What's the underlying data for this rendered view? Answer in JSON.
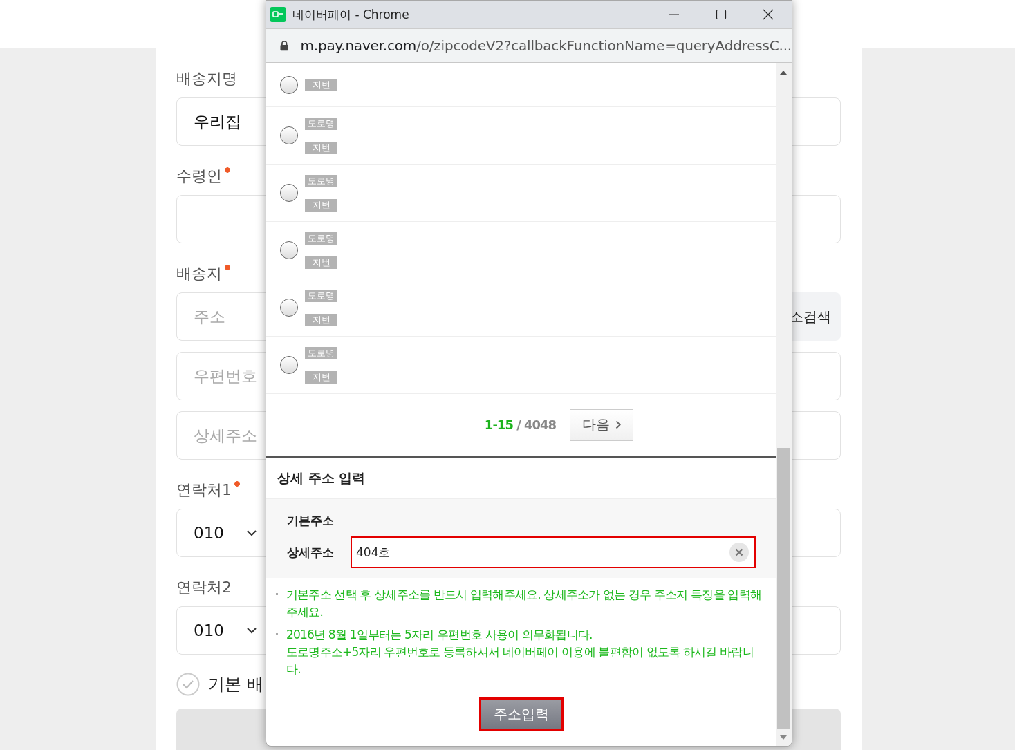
{
  "form": {
    "sections": [
      {
        "label": "배송지명",
        "required": false,
        "fields": [
          {
            "kind": "text",
            "value": "우리집"
          }
        ]
      },
      {
        "label": "수령인",
        "required": true,
        "fields": [
          {
            "kind": "text"
          }
        ]
      },
      {
        "label": "배송지",
        "required": true,
        "fields": [
          {
            "kind": "search",
            "placeholder": "주소",
            "button": "소검색"
          },
          {
            "kind": "text",
            "placeholder": "우편번호"
          },
          {
            "kind": "text",
            "placeholder": "상세주소"
          }
        ]
      },
      {
        "label": "연락처1",
        "required": true,
        "fields": [
          {
            "kind": "select",
            "value": "010"
          }
        ]
      },
      {
        "label": "연락처2",
        "required": false,
        "fields": [
          {
            "kind": "select",
            "value": "010"
          }
        ]
      }
    ],
    "default_checkbox": {
      "label": "기본 배",
      "checked": false
    }
  },
  "browser_window": {
    "title": "네이버페이 - Chrome",
    "url_host": "m.pay.naver.com",
    "url_path": "/o/zipcodeV2?callbackFunctionName=queryAddressC..."
  },
  "address_results": [
    {
      "selected": false,
      "badges": [
        "지번"
      ]
    },
    {
      "selected": false,
      "badges": [
        "도로명",
        "지번"
      ]
    },
    {
      "selected": false,
      "badges": [
        "도로명",
        "지번"
      ]
    },
    {
      "selected": false,
      "badges": [
        "도로명",
        "지번"
      ]
    },
    {
      "selected": false,
      "badges": [
        "도로명",
        "지번"
      ]
    },
    {
      "selected": false,
      "badges": [
        "도로명",
        "지번"
      ]
    }
  ],
  "pagination": {
    "range": "1-15",
    "total": "/ 4048",
    "next_button": "다음"
  },
  "detail_section": {
    "title": "상세 주소 입력",
    "base_label": "기본주소",
    "detail_label": "상세주소",
    "detail_value": "404호",
    "notes": [
      [
        "기본주소 선택 후 상세주소를 반드시 입력해주세요. 상세주소가 없는 경우 주소지 특징을 입력해주세요."
      ],
      [
        "2016년 8월 1일부터는 5자리 우편번호 사용이 의무화됩니다.",
        "도로명주소+5자리 우편번호로 등록하셔서 네이버페이 이용에 불편함이 없도록 하시길 바랍니다."
      ]
    ],
    "submit_button": "주소입력"
  }
}
